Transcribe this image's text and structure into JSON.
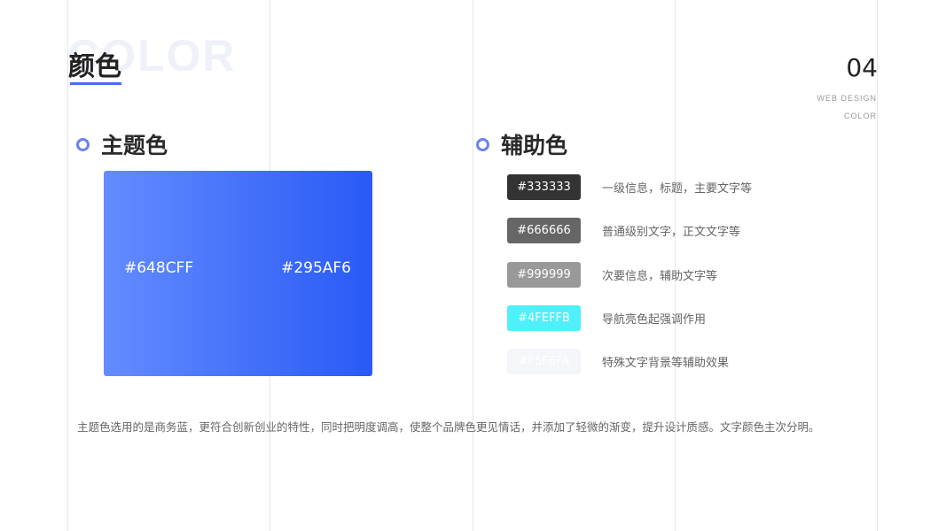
{
  "background_word": "COLOR",
  "title": "颜色",
  "page_number": "04",
  "meta": {
    "line1": "WEB DESIGN",
    "line2": "COLOR"
  },
  "primary": {
    "heading": "主题色",
    "gradient_start": "#648CFF",
    "gradient_end": "#295AF6",
    "start_label": "#648CFF",
    "end_label": "#295AF6"
  },
  "secondary": {
    "heading": "辅助色",
    "items": [
      {
        "hex": "#333333",
        "label": "#333333",
        "text_color": "#ffffff",
        "description": "一级信息，标题，主要文字等"
      },
      {
        "hex": "#666666",
        "label": "#666666",
        "text_color": "#ffffff",
        "description": "普通级别文字，正文文字等"
      },
      {
        "hex": "#999999",
        "label": "#999999",
        "text_color": "#ffffff",
        "description": "次要信息，辅助文字等"
      },
      {
        "hex": "#4FEFFB",
        "label": "#4FEFFB",
        "text_color": "#ffffff",
        "description": "导航亮色起强调作用"
      },
      {
        "hex": "#F5F6FA",
        "label": "#F5F6FA",
        "text_color": "#ffffff",
        "description": "特殊文字背景等辅助效果"
      }
    ]
  },
  "caption": "主题色选用的是商务蓝，更符合创新创业的特性，同时把明度调高，使整个品牌色更见情话，并添加了轻微的渐变，提升设计质感。文字颜色主次分明。",
  "colors": {
    "accent": "#4A6CF7",
    "dot_ring": "#6A82F5",
    "guide_line": "#E6E6EA"
  }
}
